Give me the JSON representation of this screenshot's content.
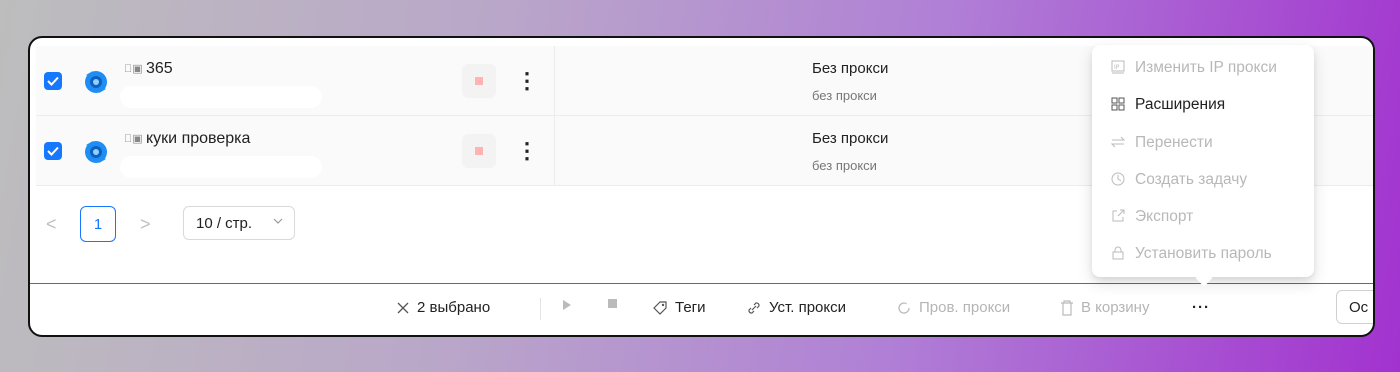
{
  "rows": [
    {
      "name": "365",
      "checked": true,
      "proxy_title": "Без прокси",
      "proxy_sub": "без прокси"
    },
    {
      "name": "куки проверка",
      "checked": true,
      "proxy_title": "Без прокси",
      "proxy_sub": "без прокси"
    }
  ],
  "pagination": {
    "prev": "<",
    "current": "1",
    "next": ">",
    "page_size": "10 / стр."
  },
  "toolbar": {
    "selected": "2 выбрано",
    "tags": "Теги",
    "set_proxy": "Уст. прокси",
    "check_proxy": "Пров. прокси",
    "trash": "В корзину",
    "more": "···",
    "extra": "Ос"
  },
  "menu": {
    "items": [
      {
        "label": "Изменить IP прокси",
        "icon": "ip-icon",
        "enabled": false
      },
      {
        "label": "Расширения",
        "icon": "grid-icon",
        "enabled": true
      },
      {
        "label": "Перенести",
        "icon": "transfer-icon",
        "enabled": false
      },
      {
        "label": "Создать задачу",
        "icon": "clock-icon",
        "enabled": false
      },
      {
        "label": "Экспорт",
        "icon": "export-icon",
        "enabled": false
      },
      {
        "label": "Установить пароль",
        "icon": "lock-icon",
        "enabled": false
      }
    ]
  },
  "colors": {
    "accent": "#1677ff",
    "disabled": "#b8b8b8",
    "stop": "#ffb3b3"
  }
}
